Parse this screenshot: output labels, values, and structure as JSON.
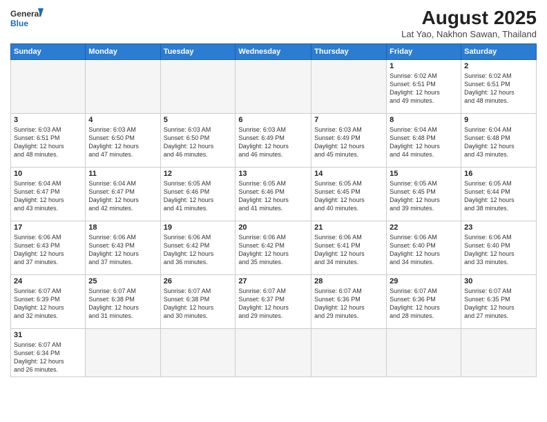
{
  "logo": {
    "line1": "General",
    "line2": "Blue"
  },
  "title": "August 2025",
  "location": "Lat Yao, Nakhon Sawan, Thailand",
  "headers": [
    "Sunday",
    "Monday",
    "Tuesday",
    "Wednesday",
    "Thursday",
    "Friday",
    "Saturday"
  ],
  "weeks": [
    [
      {
        "day": "",
        "info": ""
      },
      {
        "day": "",
        "info": ""
      },
      {
        "day": "",
        "info": ""
      },
      {
        "day": "",
        "info": ""
      },
      {
        "day": "",
        "info": ""
      },
      {
        "day": "1",
        "info": "Sunrise: 6:02 AM\nSunset: 6:51 PM\nDaylight: 12 hours\nand 49 minutes."
      },
      {
        "day": "2",
        "info": "Sunrise: 6:02 AM\nSunset: 6:51 PM\nDaylight: 12 hours\nand 48 minutes."
      }
    ],
    [
      {
        "day": "3",
        "info": "Sunrise: 6:03 AM\nSunset: 6:51 PM\nDaylight: 12 hours\nand 48 minutes."
      },
      {
        "day": "4",
        "info": "Sunrise: 6:03 AM\nSunset: 6:50 PM\nDaylight: 12 hours\nand 47 minutes."
      },
      {
        "day": "5",
        "info": "Sunrise: 6:03 AM\nSunset: 6:50 PM\nDaylight: 12 hours\nand 46 minutes."
      },
      {
        "day": "6",
        "info": "Sunrise: 6:03 AM\nSunset: 6:49 PM\nDaylight: 12 hours\nand 46 minutes."
      },
      {
        "day": "7",
        "info": "Sunrise: 6:03 AM\nSunset: 6:49 PM\nDaylight: 12 hours\nand 45 minutes."
      },
      {
        "day": "8",
        "info": "Sunrise: 6:04 AM\nSunset: 6:48 PM\nDaylight: 12 hours\nand 44 minutes."
      },
      {
        "day": "9",
        "info": "Sunrise: 6:04 AM\nSunset: 6:48 PM\nDaylight: 12 hours\nand 43 minutes."
      }
    ],
    [
      {
        "day": "10",
        "info": "Sunrise: 6:04 AM\nSunset: 6:47 PM\nDaylight: 12 hours\nand 43 minutes."
      },
      {
        "day": "11",
        "info": "Sunrise: 6:04 AM\nSunset: 6:47 PM\nDaylight: 12 hours\nand 42 minutes."
      },
      {
        "day": "12",
        "info": "Sunrise: 6:05 AM\nSunset: 6:46 PM\nDaylight: 12 hours\nand 41 minutes."
      },
      {
        "day": "13",
        "info": "Sunrise: 6:05 AM\nSunset: 6:46 PM\nDaylight: 12 hours\nand 41 minutes."
      },
      {
        "day": "14",
        "info": "Sunrise: 6:05 AM\nSunset: 6:45 PM\nDaylight: 12 hours\nand 40 minutes."
      },
      {
        "day": "15",
        "info": "Sunrise: 6:05 AM\nSunset: 6:45 PM\nDaylight: 12 hours\nand 39 minutes."
      },
      {
        "day": "16",
        "info": "Sunrise: 6:05 AM\nSunset: 6:44 PM\nDaylight: 12 hours\nand 38 minutes."
      }
    ],
    [
      {
        "day": "17",
        "info": "Sunrise: 6:06 AM\nSunset: 6:43 PM\nDaylight: 12 hours\nand 37 minutes."
      },
      {
        "day": "18",
        "info": "Sunrise: 6:06 AM\nSunset: 6:43 PM\nDaylight: 12 hours\nand 37 minutes."
      },
      {
        "day": "19",
        "info": "Sunrise: 6:06 AM\nSunset: 6:42 PM\nDaylight: 12 hours\nand 36 minutes."
      },
      {
        "day": "20",
        "info": "Sunrise: 6:06 AM\nSunset: 6:42 PM\nDaylight: 12 hours\nand 35 minutes."
      },
      {
        "day": "21",
        "info": "Sunrise: 6:06 AM\nSunset: 6:41 PM\nDaylight: 12 hours\nand 34 minutes."
      },
      {
        "day": "22",
        "info": "Sunrise: 6:06 AM\nSunset: 6:40 PM\nDaylight: 12 hours\nand 34 minutes."
      },
      {
        "day": "23",
        "info": "Sunrise: 6:06 AM\nSunset: 6:40 PM\nDaylight: 12 hours\nand 33 minutes."
      }
    ],
    [
      {
        "day": "24",
        "info": "Sunrise: 6:07 AM\nSunset: 6:39 PM\nDaylight: 12 hours\nand 32 minutes."
      },
      {
        "day": "25",
        "info": "Sunrise: 6:07 AM\nSunset: 6:38 PM\nDaylight: 12 hours\nand 31 minutes."
      },
      {
        "day": "26",
        "info": "Sunrise: 6:07 AM\nSunset: 6:38 PM\nDaylight: 12 hours\nand 30 minutes."
      },
      {
        "day": "27",
        "info": "Sunrise: 6:07 AM\nSunset: 6:37 PM\nDaylight: 12 hours\nand 29 minutes."
      },
      {
        "day": "28",
        "info": "Sunrise: 6:07 AM\nSunset: 6:36 PM\nDaylight: 12 hours\nand 29 minutes."
      },
      {
        "day": "29",
        "info": "Sunrise: 6:07 AM\nSunset: 6:36 PM\nDaylight: 12 hours\nand 28 minutes."
      },
      {
        "day": "30",
        "info": "Sunrise: 6:07 AM\nSunset: 6:35 PM\nDaylight: 12 hours\nand 27 minutes."
      }
    ],
    [
      {
        "day": "31",
        "info": "Sunrise: 6:07 AM\nSunset: 6:34 PM\nDaylight: 12 hours\nand 26 minutes."
      },
      {
        "day": "",
        "info": ""
      },
      {
        "day": "",
        "info": ""
      },
      {
        "day": "",
        "info": ""
      },
      {
        "day": "",
        "info": ""
      },
      {
        "day": "",
        "info": ""
      },
      {
        "day": "",
        "info": ""
      }
    ]
  ]
}
